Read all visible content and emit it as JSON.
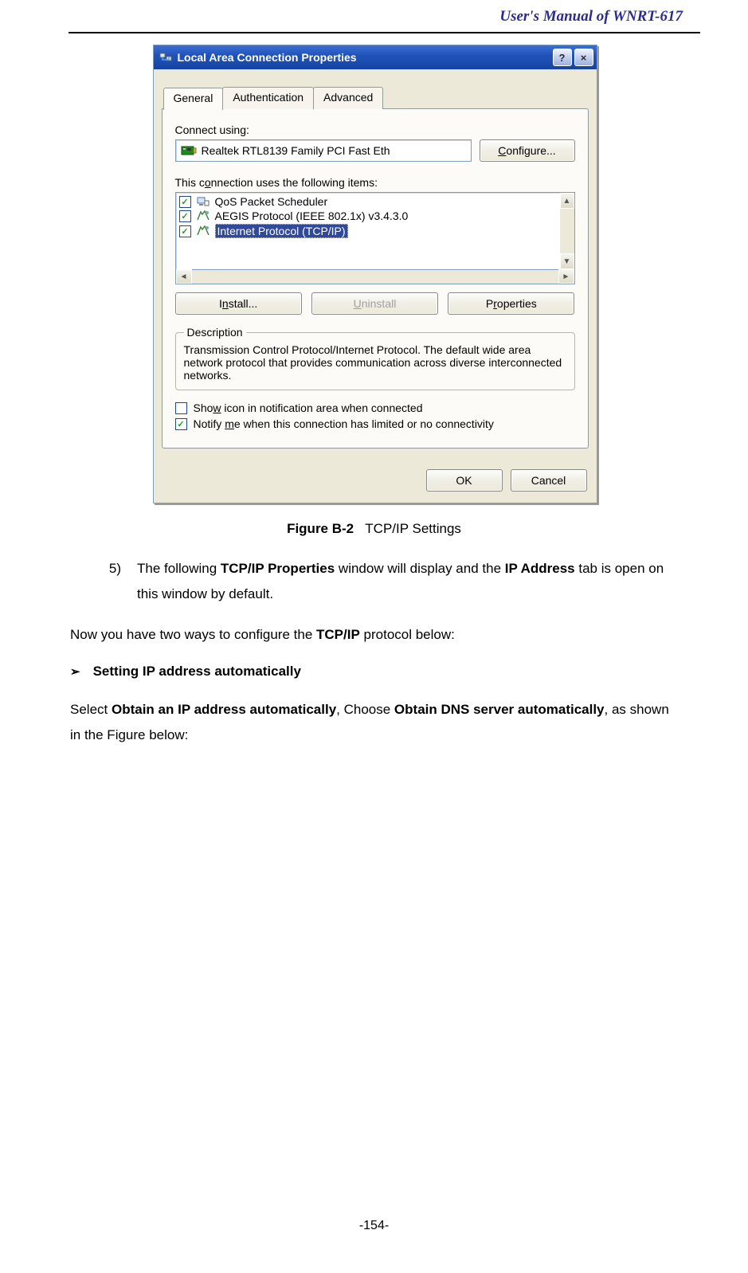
{
  "header": {
    "title": "User's  Manual  of  WNRT-617"
  },
  "dialog": {
    "title": "Local Area Connection    Properties",
    "helpBtn": "?",
    "closeBtn": "×",
    "tabs": {
      "general": "General",
      "auth": "Authentication",
      "adv": "Advanced"
    },
    "connectUsingLabel": "Connect using:",
    "adapterName": "Realtek RTL8139 Family PCI Fast Eth",
    "configureBtn": "Configure...",
    "itemsLabel": "This connection uses the following items:",
    "items": [
      {
        "label": "QoS Packet Scheduler",
        "checked": true,
        "selected": false
      },
      {
        "label": "AEGIS Protocol (IEEE 802.1x) v3.4.3.0",
        "checked": true,
        "selected": false
      },
      {
        "label": "Internet Protocol (TCP/IP)",
        "checked": true,
        "selected": true
      }
    ],
    "installBtn": "Install...",
    "uninstallBtn": "Uninstall",
    "propertiesBtn": "Properties",
    "descLegend": "Description",
    "descText": "Transmission Control Protocol/Internet Protocol. The default wide area network protocol that provides communication across diverse interconnected networks.",
    "showIconLabel": "Show icon in notification area when connected",
    "showIconChecked": "",
    "notifyLabel": "Notify me when this connection has limited or no connectivity",
    "notifyChecked": "✓",
    "okBtn": "OK",
    "cancelBtn": "Cancel"
  },
  "figure": {
    "label": "Figure B-2",
    "caption": "TCP/IP Settings"
  },
  "doc": {
    "step5_num": "5)",
    "step5_a": "The following ",
    "step5_b": "TCP/IP Properties",
    "step5_c": " window will display and the ",
    "step5_d": "IP Address",
    "step5_e": " tab is open on this window by default.",
    "line2a": "Now you have two ways to configure the ",
    "line2b": "TCP/IP",
    "line2c": " protocol below:",
    "bullet_mark": "➢",
    "bullet_text": "Setting IP address automatically",
    "line3a": "Select ",
    "line3b": "Obtain an IP address automatically",
    "line3c": ", Choose ",
    "line3d": "Obtain DNS server automatically",
    "line3e": ", as shown in the Figure below:"
  },
  "pageNumber": "-154-"
}
